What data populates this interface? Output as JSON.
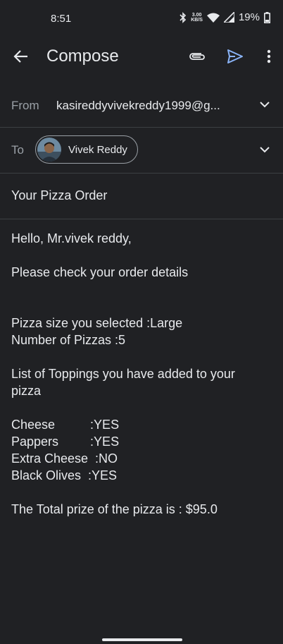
{
  "status": {
    "time": "8:51",
    "net_speed_value": "3.00",
    "net_speed_unit": "KB/S",
    "battery": "19%"
  },
  "appbar": {
    "title": "Compose"
  },
  "from": {
    "label": "From",
    "value": "kasireddyvivekreddy1999@g..."
  },
  "to": {
    "label": "To",
    "recipient": "Vivek Reddy"
  },
  "subject": "Your Pizza Order",
  "body": {
    "greeting": "Hello, Mr.vivek reddy,",
    "intro": "Please check your order details",
    "size_line": "Pizza size you selected :Large",
    "count_line": "Number of Pizzas :5",
    "toppings_line1": "List of Toppings you have added to your",
    "toppings_line2": "pizza",
    "t_cheese": "Cheese          :YES",
    "t_pappers": "Pappers         :YES",
    "t_extra": "Extra Cheese  :NO",
    "t_olives": "Black Olives  :YES",
    "total": "The Total prize of the pizza is : $95.0"
  },
  "colors": {
    "background": "#202124",
    "text": "#e8eaed",
    "secondary": "#9aa0a6",
    "send_accent": "#8ab4f8"
  }
}
